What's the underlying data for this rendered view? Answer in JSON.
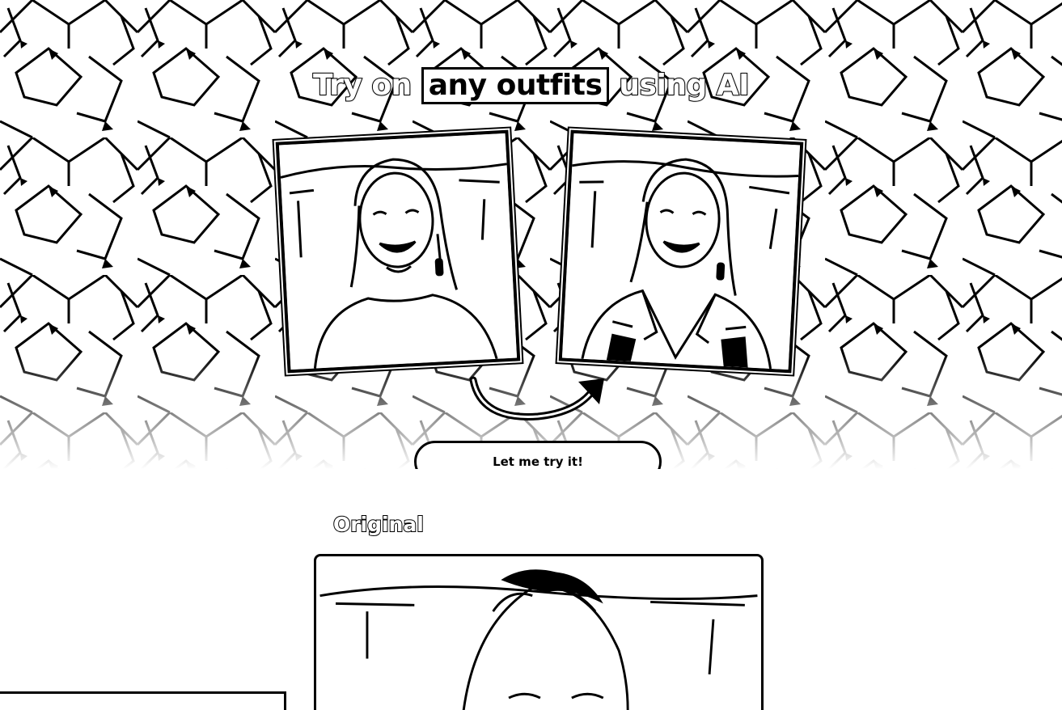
{
  "hero": {
    "headline_pre": "Try on",
    "headline_highlight": "any outfits",
    "headline_post": "using AI",
    "cta_label": "Let me try it!"
  },
  "images": {
    "before_alt": "Smiling woman with wavy hair and drop earrings wearing a plain top",
    "after_alt": "Same woman wearing a leather biker jacket",
    "original_alt": "Original photo of smiling woman"
  },
  "original": {
    "label": "Original"
  },
  "colors": {
    "ink": "#000000",
    "paper": "#ffffff"
  },
  "icons": {
    "arrow": "curved-arrow-icon"
  }
}
